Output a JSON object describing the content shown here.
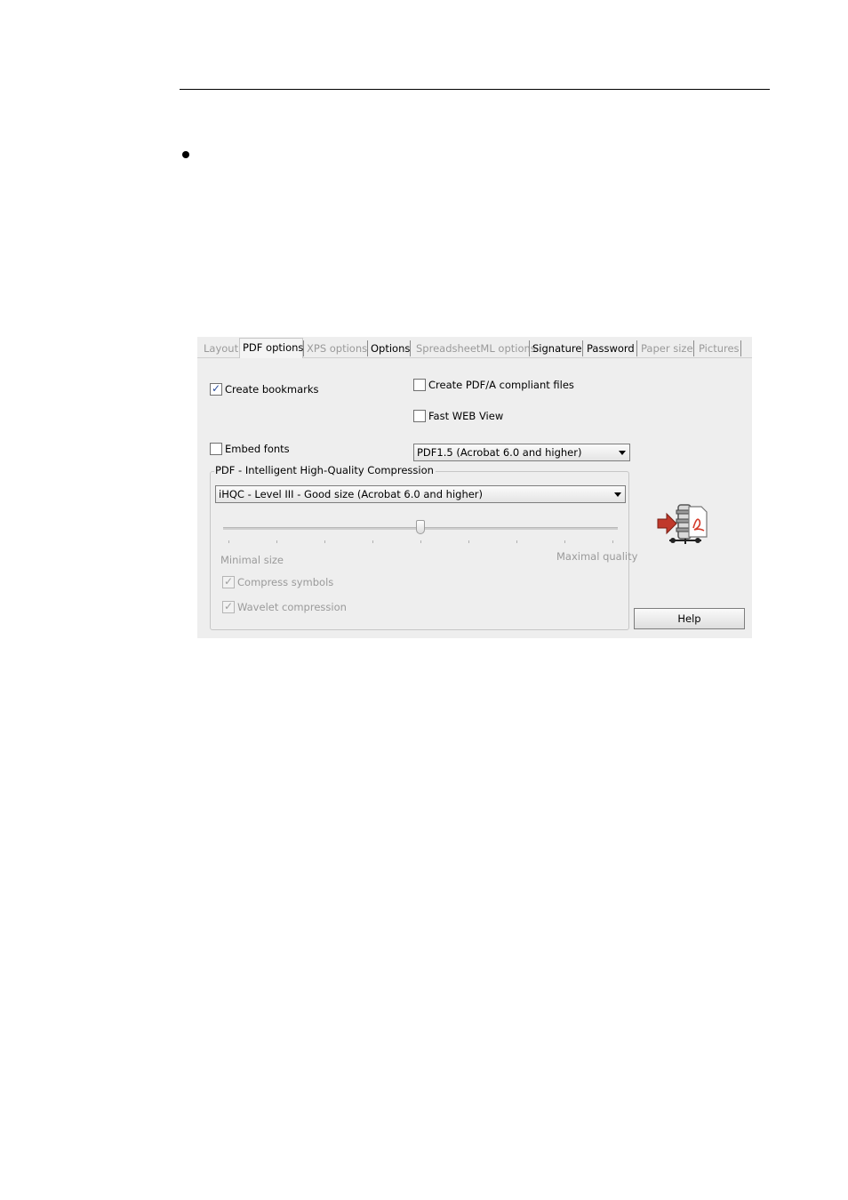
{
  "tabs": [
    {
      "label": "Layout",
      "state": "disabled"
    },
    {
      "label": "PDF options",
      "state": "active"
    },
    {
      "label": "XPS options",
      "state": "disabled"
    },
    {
      "label": "Options",
      "state": "enabled"
    },
    {
      "label": "SpreadsheetML options",
      "state": "disabled"
    },
    {
      "label": "Signature",
      "state": "enabled"
    },
    {
      "label": "Password",
      "state": "enabled"
    },
    {
      "label": "Paper size",
      "state": "disabled"
    },
    {
      "label": "Pictures",
      "state": "disabled"
    }
  ],
  "options": {
    "create_bookmarks": {
      "label": "Create bookmarks",
      "checked": true
    },
    "create_pdfa": {
      "label": "Create PDF/A compliant files",
      "checked": false
    },
    "fast_web_view": {
      "label": "Fast WEB View",
      "checked": false
    },
    "embed_fonts": {
      "label": "Embed fonts",
      "checked": false
    },
    "pdf_version": {
      "value": "PDF1.5 (Acrobat 6.0 and higher)"
    }
  },
  "compression": {
    "title": "PDF - Intelligent High-Quality Compression",
    "level": "iHQC - Level III - Good size (Acrobat 6.0 and higher)",
    "slider_position": 0.5,
    "min_label": "Minimal size",
    "max_label": "Maximal quality",
    "compress_symbols": {
      "label": "Compress symbols",
      "checked": true,
      "disabled": true
    },
    "wavelet_compression": {
      "label": "Wavelet compression",
      "checked": true,
      "disabled": true
    }
  },
  "help_label": "Help",
  "icons": {
    "compress": "pdf-compress-icon",
    "check": "checkmark-icon",
    "dropdown": "chevron-down-icon"
  },
  "colors": {
    "dialog_bg": "#eeeeee",
    "check_mark": "#2a4d9b",
    "disabled_text": "#9a9a9a",
    "arrow_red": "#c0392b"
  }
}
